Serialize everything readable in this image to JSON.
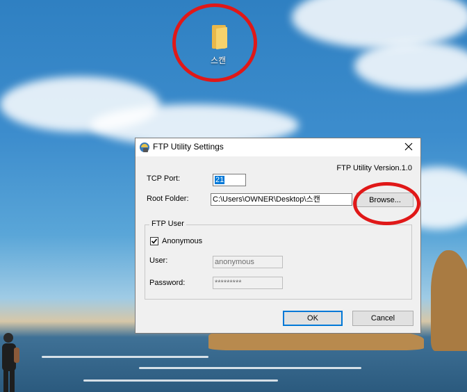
{
  "desktop": {
    "folder_label": "스캔"
  },
  "dialog": {
    "title": "FTP Utility Settings",
    "version": "FTP Utility Version.1.0",
    "tcp_port_label": "TCP Port:",
    "tcp_port_value": "21",
    "root_folder_label": "Root Folder:",
    "root_folder_value": "C:\\Users\\OWNER\\Desktop\\스캔",
    "browse_label": "Browse...",
    "ftp_user_group": "FTP User",
    "anonymous_label": "Anonymous",
    "anonymous_checked": true,
    "user_label": "User:",
    "user_value": "anonymous",
    "password_label": "Password:",
    "password_value": "*********",
    "ok_label": "OK",
    "cancel_label": "Cancel"
  },
  "icons": {
    "folder": "folder-icon",
    "app": "ftp-app-icon",
    "close": "close-icon",
    "check": "check-icon"
  },
  "colors": {
    "annotation_circle": "#e01818",
    "selection": "#0078d7"
  }
}
